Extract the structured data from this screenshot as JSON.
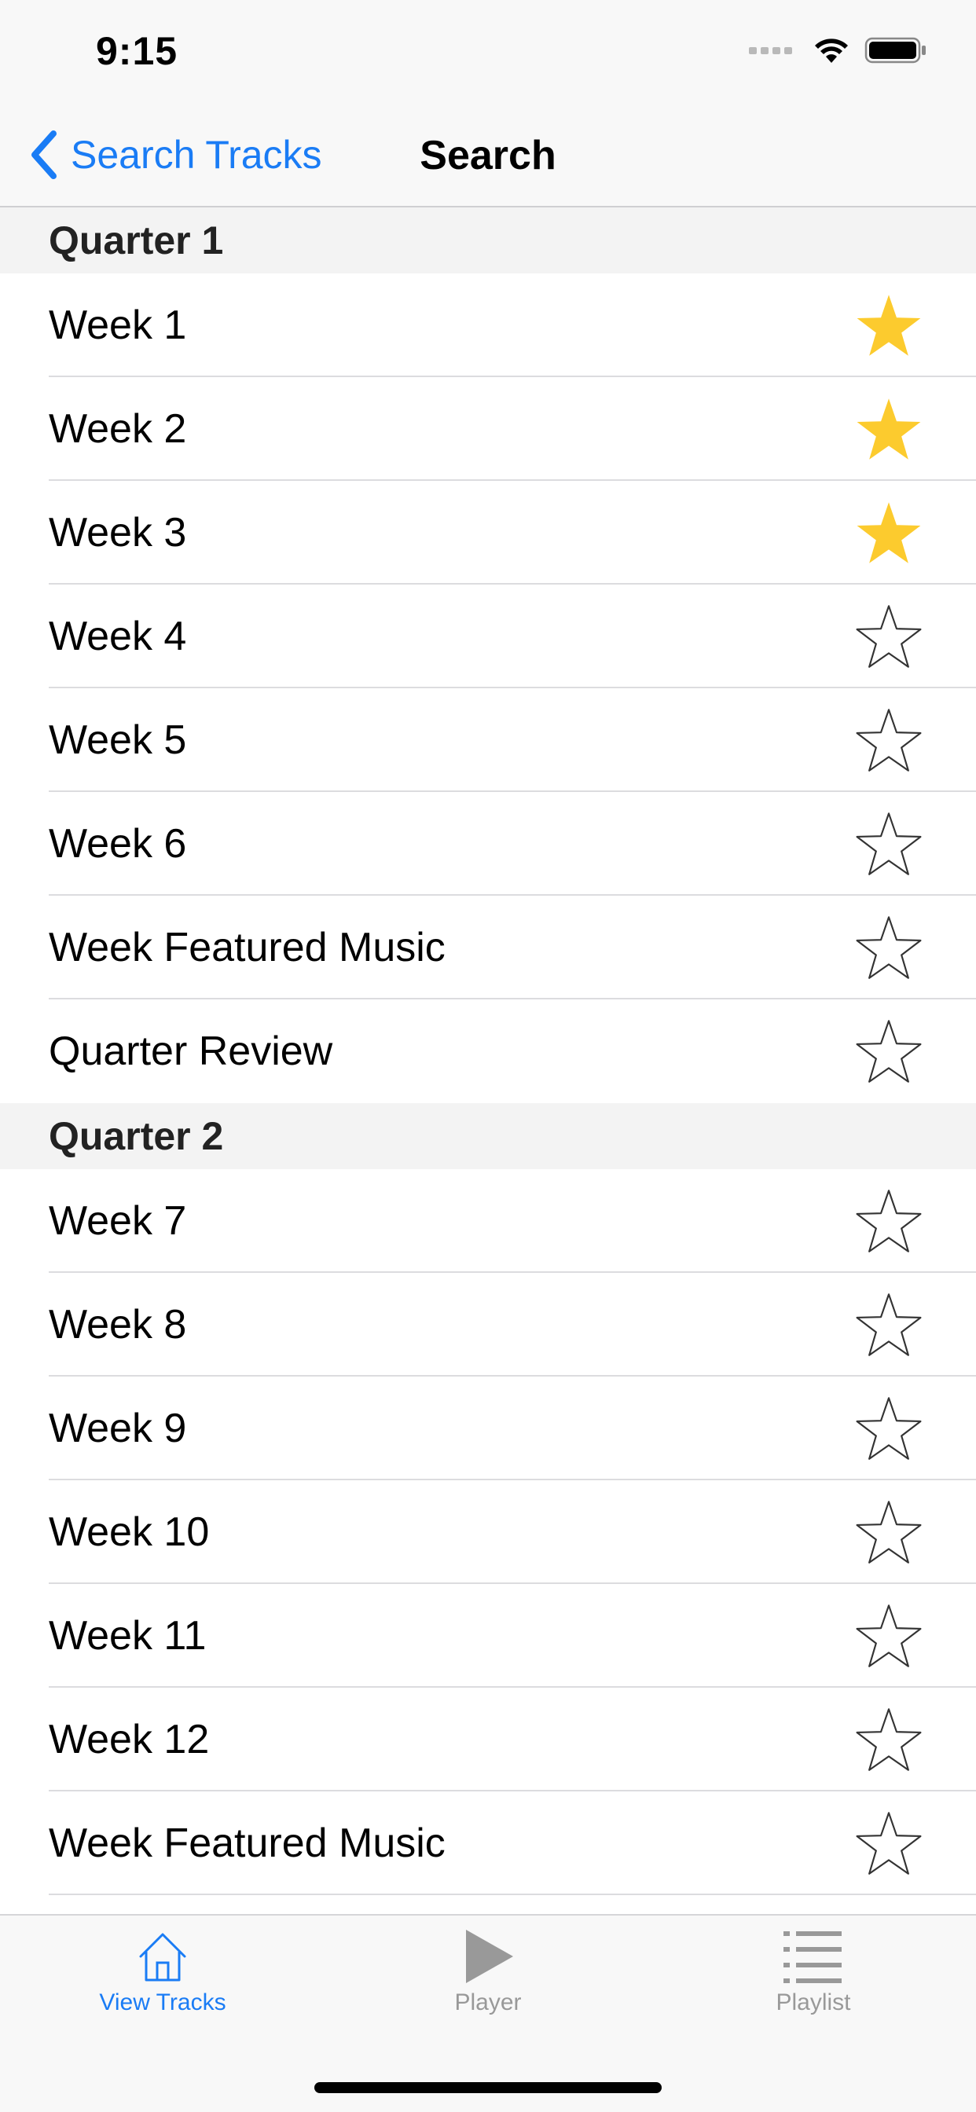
{
  "status_bar": {
    "time": "9:15"
  },
  "nav": {
    "back_label": "Search Tracks",
    "title": "Search"
  },
  "sections": [
    {
      "title": "Quarter 1",
      "rows": [
        {
          "label": "Week 1",
          "favorite": true
        },
        {
          "label": "Week 2",
          "favorite": true
        },
        {
          "label": "Week 3",
          "favorite": true
        },
        {
          "label": "Week 4",
          "favorite": false
        },
        {
          "label": "Week 5",
          "favorite": false
        },
        {
          "label": "Week 6",
          "favorite": false
        },
        {
          "label": "Week Featured Music",
          "favorite": false
        },
        {
          "label": "Quarter Review",
          "favorite": false
        }
      ]
    },
    {
      "title": "Quarter 2",
      "rows": [
        {
          "label": "Week 7",
          "favorite": false
        },
        {
          "label": "Week 8",
          "favorite": false
        },
        {
          "label": "Week 9",
          "favorite": false
        },
        {
          "label": "Week 10",
          "favorite": false
        },
        {
          "label": "Week 11",
          "favorite": false
        },
        {
          "label": "Week 12",
          "favorite": false
        },
        {
          "label": "Week Featured Music",
          "favorite": false
        }
      ]
    }
  ],
  "tabs": [
    {
      "label": "View Tracks",
      "icon": "home-icon",
      "active": true
    },
    {
      "label": "Player",
      "icon": "play-icon",
      "active": false
    },
    {
      "label": "Playlist",
      "icon": "list-icon",
      "active": false
    }
  ],
  "colors": {
    "accent": "#1a7cf5",
    "star_filled": "#fccb2e",
    "star_outline": "#333333",
    "tab_inactive": "#999999"
  }
}
